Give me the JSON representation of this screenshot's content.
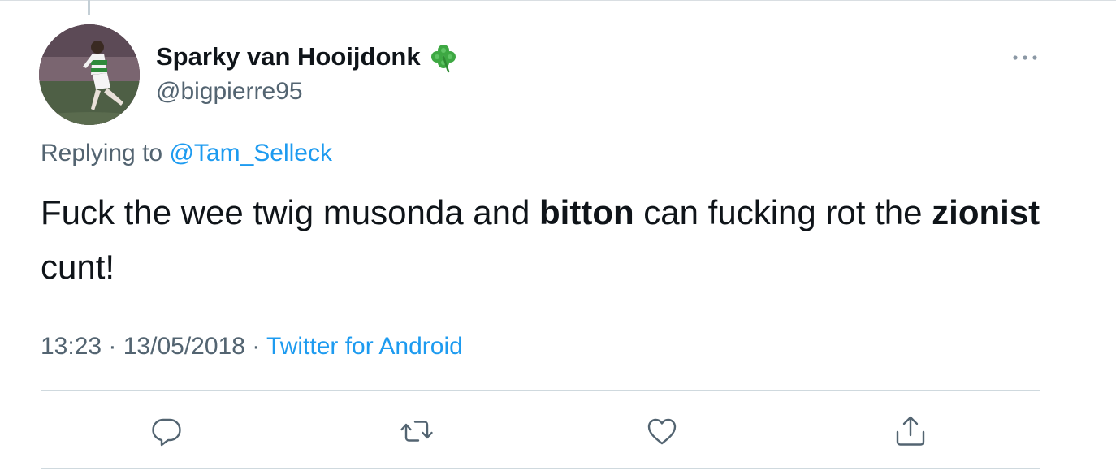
{
  "tweet": {
    "display_name": "Sparky van Hooijdonk",
    "name_emoji": "shamrock-icon",
    "handle": "@bigpierre95",
    "replying_prefix": "Replying to",
    "replying_to": "@Tam_Selleck",
    "text_segments": [
      {
        "text": "Fuck the wee twig musonda and ",
        "bold": false
      },
      {
        "text": "bitton",
        "bold": true
      },
      {
        "text": " can fucking rot the ",
        "bold": false
      },
      {
        "text": "zionist",
        "bold": true
      },
      {
        "text": " cunt!",
        "bold": false
      }
    ],
    "time": "13:23",
    "separator": " · ",
    "date": "13/05/2018",
    "source": "Twitter for Android"
  },
  "actions": [
    {
      "name": "reply-icon"
    },
    {
      "name": "retweet-icon"
    },
    {
      "name": "like-icon"
    },
    {
      "name": "share-icon"
    }
  ],
  "colors": {
    "text": "#0f1419",
    "secondary": "#536471",
    "link": "#1d9bf0",
    "icon": "#536471",
    "clover": "#3ea843"
  }
}
